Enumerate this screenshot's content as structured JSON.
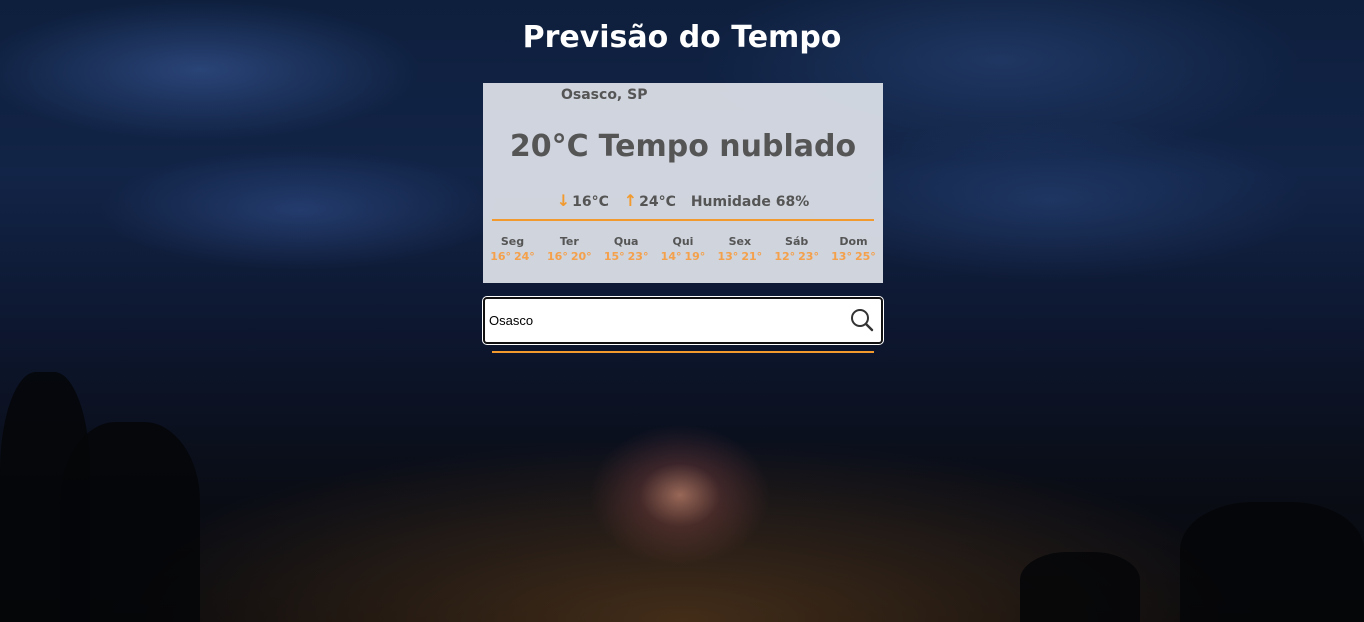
{
  "page": {
    "title": "Previsão do Tempo"
  },
  "current": {
    "city": "Osasco, SP",
    "temperature": "20°C",
    "description": "Tempo nublado",
    "min": "16°C",
    "max": "24°C",
    "humidity": "Humidade 68%"
  },
  "forecast": [
    {
      "day": "Seg",
      "min": "16°",
      "max": "24°"
    },
    {
      "day": "Ter",
      "min": "16°",
      "max": "20°"
    },
    {
      "day": "Qua",
      "min": "15°",
      "max": "23°"
    },
    {
      "day": "Qui",
      "min": "14°",
      "max": "19°"
    },
    {
      "day": "Sex",
      "min": "13°",
      "max": "21°"
    },
    {
      "day": "Sáb",
      "min": "12°",
      "max": "23°"
    },
    {
      "day": "Dom",
      "min": "13°",
      "max": "25°"
    }
  ],
  "search": {
    "value": "Osasco",
    "icon": "search-icon"
  },
  "colors": {
    "accent": "#f29a2e",
    "text": "#555555",
    "title": "#ffffff"
  }
}
